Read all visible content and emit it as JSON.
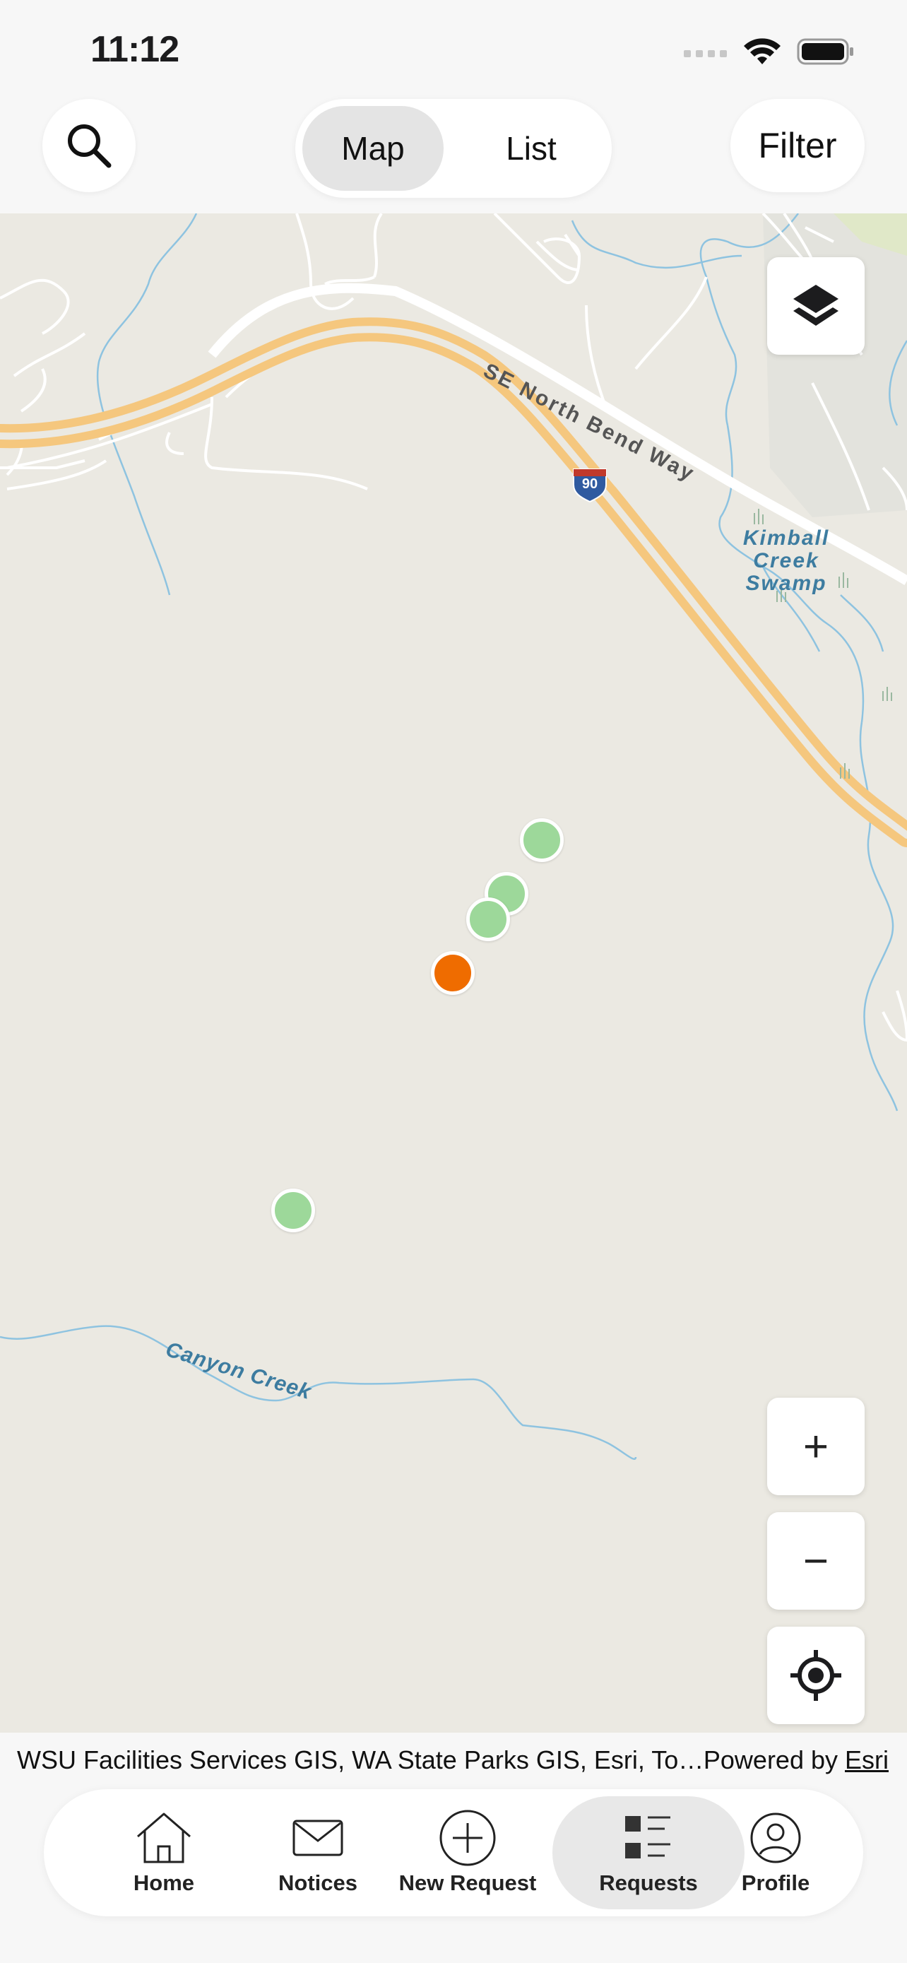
{
  "status_bar": {
    "time": "11:12"
  },
  "header": {
    "segments": [
      {
        "label": "Map",
        "selected": true
      },
      {
        "label": "List",
        "selected": false
      }
    ],
    "filter_label": "Filter"
  },
  "map": {
    "labels": {
      "road": "SE North Bend Way",
      "swamp_line1": "Kimball",
      "swamp_line2": "Creek",
      "swamp_line3": "Swamp",
      "creek": "Canyon Creek",
      "highway_shield": "90"
    },
    "marker_colors": {
      "closed": "#9dd89a",
      "open": "#ef6c00"
    },
    "controls": {
      "zoom_in": "+",
      "zoom_out": "−"
    }
  },
  "attribution": {
    "sources": "WSU Facilities Services GIS, WA State Parks GIS, Esri, To…",
    "powered_prefix": "Powered by ",
    "powered_link": "Esri"
  },
  "tabbar": {
    "items": [
      {
        "label": "Home",
        "icon": "home-icon"
      },
      {
        "label": "Notices",
        "icon": "envelope-icon"
      },
      {
        "label": "New Request",
        "icon": "plus-circle-icon"
      },
      {
        "label": "Requests",
        "icon": "list-icon",
        "active": true
      },
      {
        "label": "Profile",
        "icon": "person-icon"
      }
    ]
  }
}
